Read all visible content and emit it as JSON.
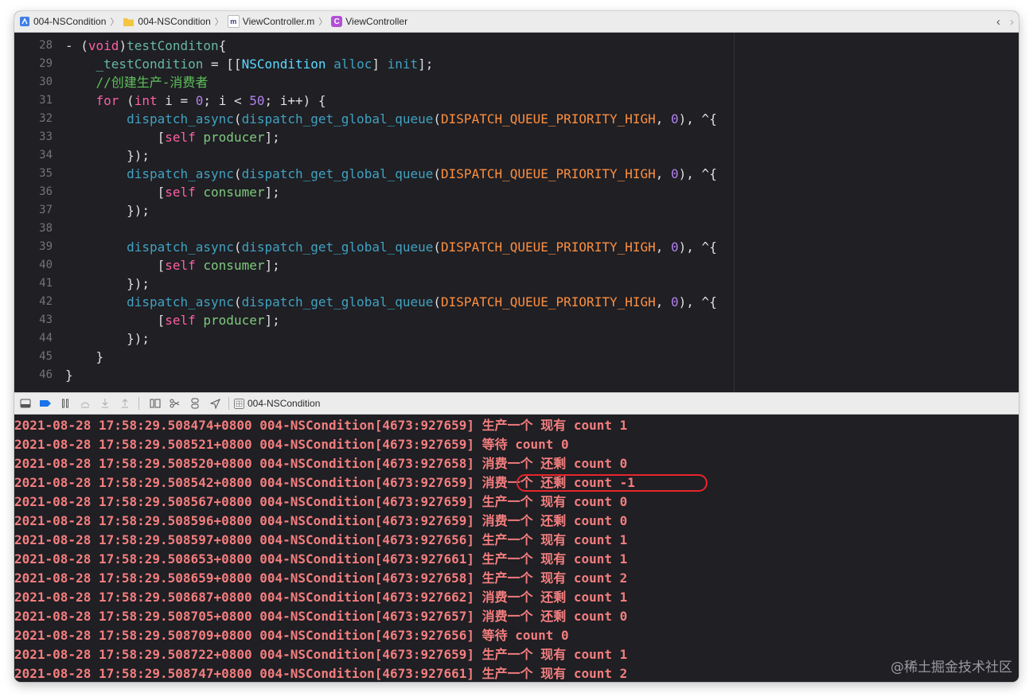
{
  "breadcrumb": [
    {
      "label": "004-NSCondition",
      "icon": "project-icon"
    },
    {
      "label": "004-NSCondition",
      "icon": "folder-icon"
    },
    {
      "label": "ViewController.m",
      "icon": "objc-file-icon",
      "icon_text": "m"
    },
    {
      "label": "ViewController",
      "icon": "class-icon",
      "icon_text": "C"
    }
  ],
  "nav": {
    "back": "‹",
    "forward": "›"
  },
  "code_lines": [
    {
      "n": "28",
      "html": "- (<span class=\"kw\">void</span>)<span class=\"fn\">testConditon</span>{"
    },
    {
      "n": "29",
      "html": "    <span class=\"ivar\">_testCondition</span> = [[<span class=\"cls\">NSCondition</span> <span class=\"lib\">alloc</span>] <span class=\"lib\">init</span>];"
    },
    {
      "n": "30",
      "html": "    <span class=\"green\">//创建生产-消费者</span>"
    },
    {
      "n": "31",
      "html": "    <span class=\"kw\">for</span> (<span class=\"kw\">int</span> i = <span class=\"pm\">0</span>; i &lt; <span class=\"pm\">50</span>; i++) {"
    },
    {
      "n": "32",
      "html": "        <span class=\"lib\">dispatch_async</span>(<span class=\"lib\">dispatch_get_global_queue</span>(<span class=\"mac\">DISPATCH_QUEUE_PRIORITY_HIGH</span>, <span class=\"pm\">0</span>), ^{"
    },
    {
      "n": "33",
      "html": "            [<span class=\"kw\">self</span> <span class=\"mname\">producer</span>];"
    },
    {
      "n": "34",
      "html": "        });"
    },
    {
      "n": "35",
      "html": "        <span class=\"lib\">dispatch_async</span>(<span class=\"lib\">dispatch_get_global_queue</span>(<span class=\"mac\">DISPATCH_QUEUE_PRIORITY_HIGH</span>, <span class=\"pm\">0</span>), ^{"
    },
    {
      "n": "36",
      "html": "            [<span class=\"kw\">self</span> <span class=\"mname\">consumer</span>];"
    },
    {
      "n": "37",
      "html": "        });"
    },
    {
      "n": "38",
      "html": ""
    },
    {
      "n": "39",
      "html": "        <span class=\"lib\">dispatch_async</span>(<span class=\"lib\">dispatch_get_global_queue</span>(<span class=\"mac\">DISPATCH_QUEUE_PRIORITY_HIGH</span>, <span class=\"pm\">0</span>), ^{"
    },
    {
      "n": "40",
      "html": "            [<span class=\"kw\">self</span> <span class=\"mname\">consumer</span>];"
    },
    {
      "n": "41",
      "html": "        });"
    },
    {
      "n": "42",
      "html": "        <span class=\"lib\">dispatch_async</span>(<span class=\"lib\">dispatch_get_global_queue</span>(<span class=\"mac\">DISPATCH_QUEUE_PRIORITY_HIGH</span>, <span class=\"pm\">0</span>), ^{"
    },
    {
      "n": "43",
      "html": "            [<span class=\"kw\">self</span> <span class=\"mname\">producer</span>];"
    },
    {
      "n": "44",
      "html": "        });"
    },
    {
      "n": "45",
      "html": "    }"
    },
    {
      "n": "46",
      "html": "}"
    }
  ],
  "debug_bar": {
    "target_label": "004-NSCondition",
    "buttons": [
      {
        "name": "hide-debug-area-icon"
      },
      {
        "name": "breakpoints-toggle-icon"
      },
      {
        "name": "pause-icon"
      },
      {
        "name": "step-over-icon"
      },
      {
        "name": "step-into-icon"
      },
      {
        "name": "step-out-icon"
      },
      {
        "name": "view-debugger-icon"
      },
      {
        "name": "memory-graph-icon"
      },
      {
        "name": "environment-overrides-icon"
      },
      {
        "name": "simulate-location-icon"
      }
    ]
  },
  "console_lines": [
    "2021-08-28 17:58:29.508474+0800 004-NSCondition[4673:927659] 生产一个 现有 count 1",
    "2021-08-28 17:58:29.508521+0800 004-NSCondition[4673:927659] 等待 count 0",
    "2021-08-28 17:58:29.508520+0800 004-NSCondition[4673:927658] 消费一个 还剩 count 0",
    "2021-08-28 17:58:29.508542+0800 004-NSCondition[4673:927659] 消费一个 还剩 count -1",
    "2021-08-28 17:58:29.508567+0800 004-NSCondition[4673:927659] 生产一个 现有 count 0",
    "2021-08-28 17:58:29.508596+0800 004-NSCondition[4673:927659] 消费一个 还剩 count 0",
    "2021-08-28 17:58:29.508597+0800 004-NSCondition[4673:927656] 生产一个 现有 count 1",
    "2021-08-28 17:58:29.508653+0800 004-NSCondition[4673:927661] 生产一个 现有 count 1",
    "2021-08-28 17:58:29.508659+0800 004-NSCondition[4673:927658] 生产一个 现有 count 2",
    "2021-08-28 17:58:29.508687+0800 004-NSCondition[4673:927662] 消费一个 还剩 count 1",
    "2021-08-28 17:58:29.508705+0800 004-NSCondition[4673:927657] 消费一个 还剩 count 0",
    "2021-08-28 17:58:29.508709+0800 004-NSCondition[4673:927656] 等待 count 0",
    "2021-08-28 17:58:29.508722+0800 004-NSCondition[4673:927659] 生产一个 现有 count 1",
    "2021-08-28 17:58:29.508747+0800 004-NSCondition[4673:927661] 生产一个 现有 count 2"
  ],
  "watermark": "@稀土掘金技术社区",
  "colors": {
    "highlight": "#e8262b",
    "console_text": "#f47e7e",
    "editor_bg": "#1f1f24"
  }
}
